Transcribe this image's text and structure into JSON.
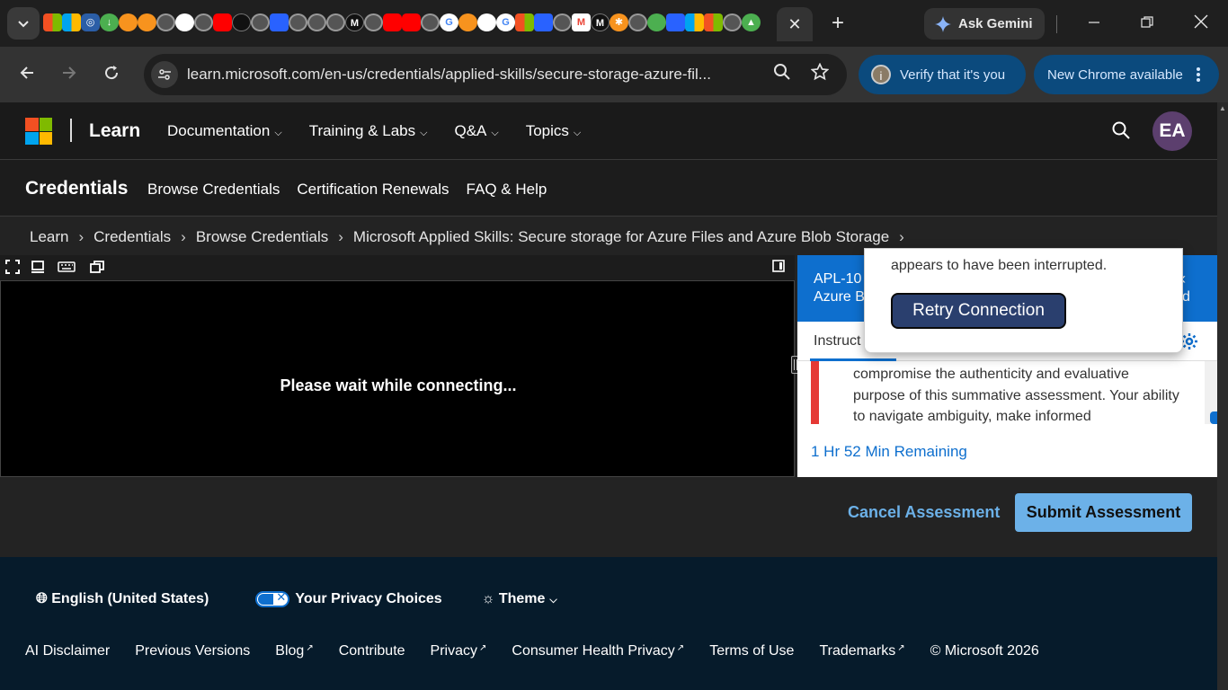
{
  "browser": {
    "active_tab_close": "✕",
    "new_tab": "+",
    "ask_gemini": "Ask Gemini",
    "url": "learn.microsoft.com/en-us/credentials/applied-skills/secure-storage-azure-fil...",
    "verify_label": "Verify that it's you",
    "update_label": "New Chrome available"
  },
  "learn": {
    "brand": "Learn",
    "nav": [
      "Documentation",
      "Training & Labs",
      "Q&A",
      "Topics"
    ],
    "avatar": "EA"
  },
  "credentials": {
    "title": "Credentials",
    "nav": [
      "Browse Credentials",
      "Certification Renewals",
      "FAQ & Help"
    ]
  },
  "breadcrumb": [
    "Learn",
    "Credentials",
    "Browse Credentials",
    "Microsoft Applied Skills: Secure storage for Azure Files and Azure Blob Storage"
  ],
  "vm": {
    "message": "Please wait while connecting..."
  },
  "panel": {
    "head_line1": "APL-10",
    "head_line2": "Azure B",
    "head_right1": "«",
    "head_right2": "d",
    "tab_label": "Instruct",
    "body_text": "compromise the authenticity and evaluative purpose of this summative assessment. Your ability to navigate ambiguity, make informed",
    "timer": "1 Hr 52 Min Remaining"
  },
  "popup": {
    "text": "appears to have been interrupted.",
    "retry_label": "Retry Connection"
  },
  "actions": {
    "cancel": "Cancel Assessment",
    "submit": "Submit Assessment"
  },
  "footer": {
    "language": "English (United States)",
    "privacy": "Your Privacy Choices",
    "theme": "Theme",
    "links": [
      "AI Disclaimer",
      "Previous Versions",
      "Blog",
      "Contribute",
      "Privacy",
      "Consumer Health Privacy",
      "Terms of Use",
      "Trademarks"
    ],
    "copyright": "© Microsoft 2026"
  }
}
